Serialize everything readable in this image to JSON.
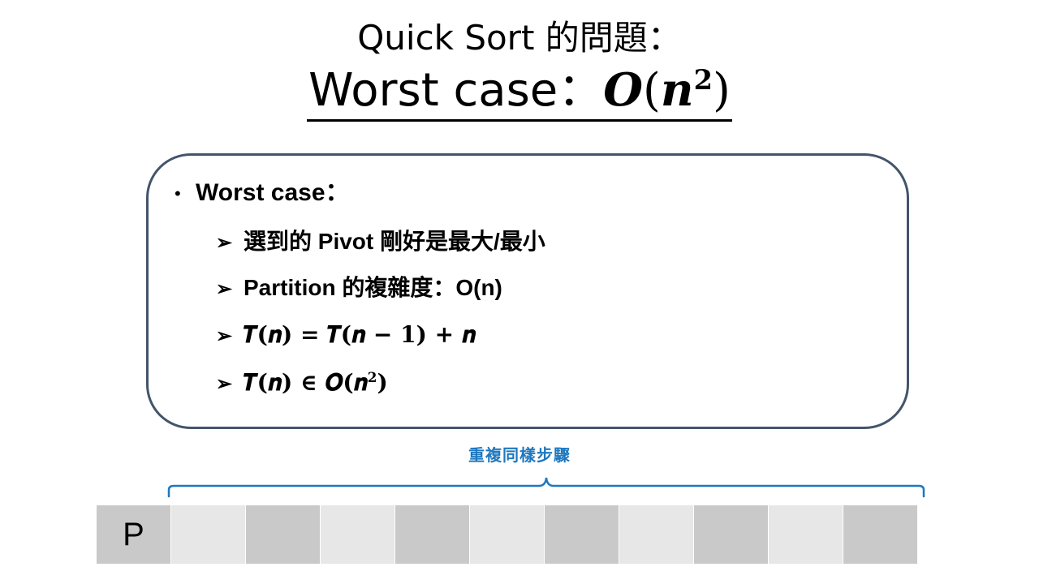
{
  "slide": {
    "title_line1": "Quick Sort 的問題：",
    "title_line2_text": "Worst case：",
    "title_line2_math": {
      "O": "O",
      "paren_open": "(",
      "n": "n",
      "exp": "2",
      "paren_close": ")"
    }
  },
  "panel": {
    "main_bullet": "Worst case：",
    "items": [
      {
        "text": "選到的 Pivot 剛好是最大/最小"
      },
      {
        "text": "Partition 的複雜度：O(n)"
      },
      {
        "math": "𝑻(𝒏) = 𝑻(𝒏 − 𝟏) + 𝒏"
      },
      {
        "math_prefix": "𝑻(𝒏) ∈ 𝑶(𝒏",
        "math_exp": "𝟐",
        "math_suffix": ")"
      }
    ]
  },
  "bottom": {
    "repeat_label": "重複同樣步驟",
    "first_cell_label": "P",
    "cell_count": 11,
    "brace_color": "#1f78bf"
  },
  "colors": {
    "panel_border": "#44546a",
    "cell_dark": "#c9c9c9",
    "cell_light": "#e7e7e7",
    "accent_blue": "#1f78bf"
  }
}
